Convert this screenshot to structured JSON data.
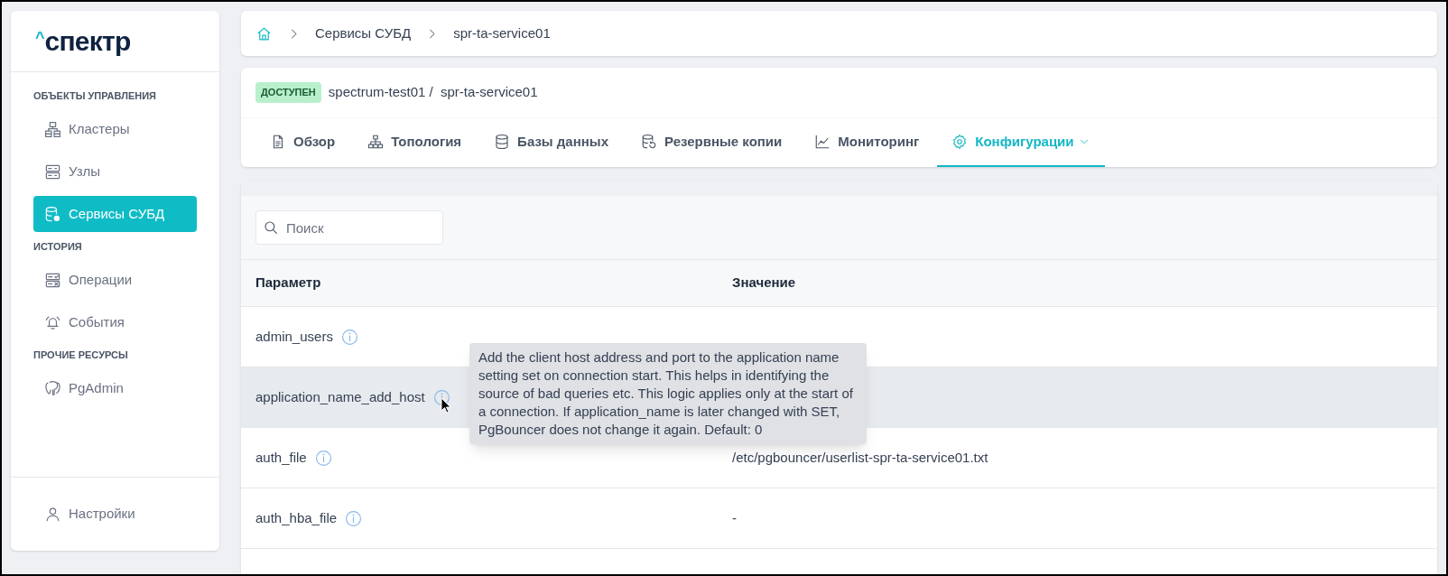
{
  "sidebar": {
    "logo": {
      "mark": "^",
      "text": "спектр"
    },
    "sections": [
      {
        "title": "ОБЪЕКТЫ УПРАВЛЕНИЯ",
        "items": [
          {
            "label": "Кластеры",
            "kind": "cluster",
            "selected": false
          },
          {
            "label": "Узлы",
            "kind": "server",
            "selected": false
          },
          {
            "label": "Сервисы СУБД",
            "kind": "dbgear",
            "selected": true
          }
        ]
      },
      {
        "title": "ИСТОРИЯ",
        "items": [
          {
            "label": "Операции",
            "kind": "ops",
            "selected": false
          },
          {
            "label": "События",
            "kind": "bell",
            "selected": false
          }
        ]
      },
      {
        "title": "ПРОЧИЕ РЕСУРСЫ",
        "items": [
          {
            "label": "PgAdmin",
            "kind": "elephant",
            "selected": false
          }
        ]
      }
    ],
    "footer": {
      "label": "Настройки"
    }
  },
  "breadcrumbs": [
    "Сервисы СУБД",
    "spr-ta-service01"
  ],
  "header": {
    "status": "ДОСТУПЕН",
    "path": "spectrum-test01 /  spr-ta-service01"
  },
  "tabs": [
    {
      "label": "Обзор",
      "kind": "doc",
      "selected": false
    },
    {
      "label": "Топология",
      "kind": "topo",
      "selected": false
    },
    {
      "label": "Базы данных",
      "kind": "db",
      "selected": false
    },
    {
      "label": "Резервные копии",
      "kind": "backup",
      "selected": false
    },
    {
      "label": "Мониторинг",
      "kind": "chart",
      "selected": false
    },
    {
      "label": "Конфигурации",
      "kind": "gear",
      "selected": true,
      "dropdown": true
    }
  ],
  "search": {
    "placeholder": "Поиск"
  },
  "table": {
    "columns": [
      "Параметр",
      "Значение"
    ],
    "rows": [
      {
        "name": "admin_users",
        "hovered": false
      },
      {
        "name": "application_name_add_host",
        "hovered": true
      },
      {
        "name": "auth_file",
        "value": "/etc/pgbouncer/userlist-spr-ta-service01.txt",
        "hovered": false
      },
      {
        "name": "auth_hba_file",
        "value": "-",
        "hovered": false
      }
    ]
  },
  "tooltip": "Add the client host address and port to the application name setting set on connection start. This helps in identifying the source of bad queries etc. This logic applies only at the start of a connection. If application_name is later changed with SET, PgBouncer does not change it again. Default: 0"
}
